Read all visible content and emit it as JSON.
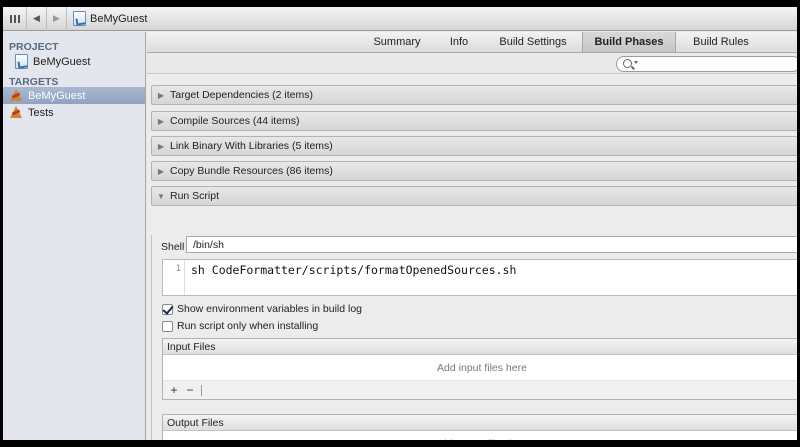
{
  "jumpbar": {
    "back_label": "◀",
    "forward_label": "▶",
    "crumb": "BeMyGuest"
  },
  "sidebar": {
    "project_heading": "PROJECT",
    "project_name": "BeMyGuest",
    "targets_heading": "TARGETS",
    "targets": [
      {
        "label": "BeMyGuest",
        "selected": true
      },
      {
        "label": "Tests",
        "selected": false
      }
    ]
  },
  "tabs": [
    {
      "label": "Summary",
      "active": false
    },
    {
      "label": "Info",
      "active": false
    },
    {
      "label": "Build Settings",
      "active": false
    },
    {
      "label": "Build Phases",
      "active": true
    },
    {
      "label": "Build Rules",
      "active": false
    }
  ],
  "search": {
    "placeholder": ""
  },
  "phases": {
    "target_dependencies": "Target Dependencies (2 items)",
    "compile_sources": "Compile Sources (44 items)",
    "link_binary": "Link Binary With Libraries (5 items)",
    "copy_bundle": "Copy Bundle Resources (86 items)",
    "run_script": "Run Script"
  },
  "run_script": {
    "shell_label": "Shell",
    "shell_value": "/bin/sh",
    "line_number": "1",
    "script_text": "sh CodeFormatter/scripts/formatOpenedSources.sh",
    "show_env_label": "Show environment variables in build log",
    "show_env_checked": true,
    "run_only_installing_label": "Run script only when installing",
    "run_only_installing_checked": false,
    "input_files": {
      "header": "Input Files",
      "empty_text": "Add input files here",
      "add_label": "+",
      "remove_label": "−"
    },
    "output_files": {
      "header": "Output Files",
      "empty_text": "Add output files here"
    }
  },
  "colors": {
    "selected_row": "#9aabc6",
    "sidebar_bg": "#e3e7ed",
    "heading_text": "#5a6a85"
  }
}
